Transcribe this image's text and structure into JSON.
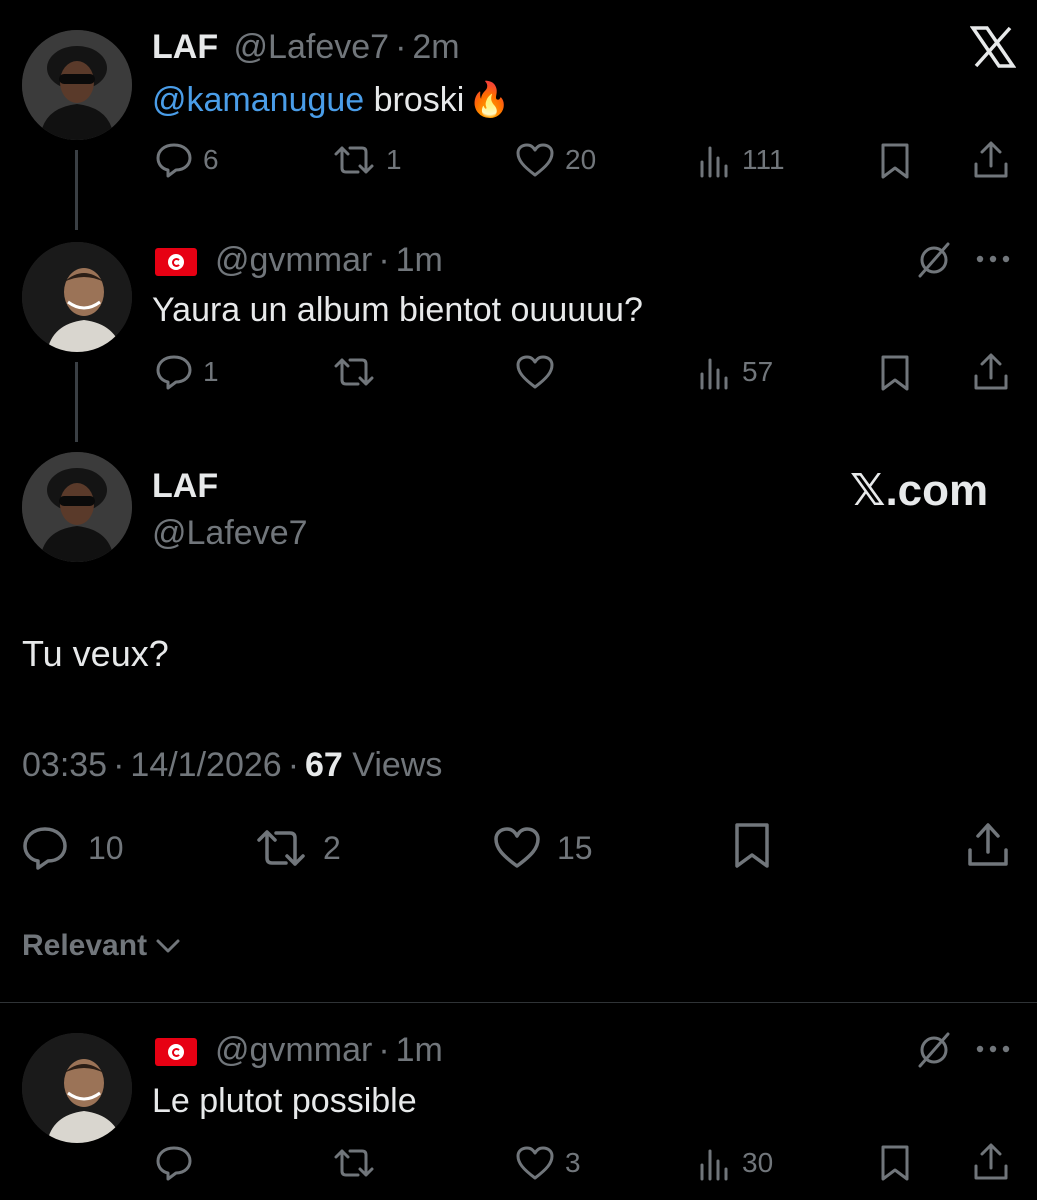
{
  "tweet1": {
    "name": "LAF",
    "handle": "@Lafeve7",
    "sep": "·",
    "time": "2m",
    "mention": "@kamanugue",
    "text": " broski",
    "emoji": "🔥",
    "replies": "6",
    "reposts": "1",
    "likes": "20",
    "views": "111"
  },
  "tweet2": {
    "flag": "tunisia-flag",
    "handle": "@gvmmar",
    "sep": "·",
    "time": "1m",
    "text": "Yaura un album bientot ouuuuu?",
    "replies": "1",
    "reposts": "",
    "likes": "",
    "views": "57"
  },
  "main": {
    "name": "LAF",
    "handle": "@Lafeve7",
    "watermark": "𝕏.com",
    "text": "Tu veux?",
    "time": "03:35",
    "sep1": "·",
    "date": "14/1/2026",
    "sep2": "·",
    "views_count": "67",
    "views_label": " Views",
    "replies": "10",
    "reposts": "2",
    "likes": "15"
  },
  "sort": {
    "label": "Relevant"
  },
  "reply1": {
    "flag": "tunisia-flag",
    "handle": "@gvmmar",
    "sep": "·",
    "time": "1m",
    "text": "Le plutot possible",
    "replies": "",
    "reposts": "",
    "likes": "3",
    "views": "30"
  },
  "colors": {
    "background": "#000000",
    "text": "#e7e9ea",
    "muted": "#71767b",
    "mention": "#4a9de8"
  }
}
